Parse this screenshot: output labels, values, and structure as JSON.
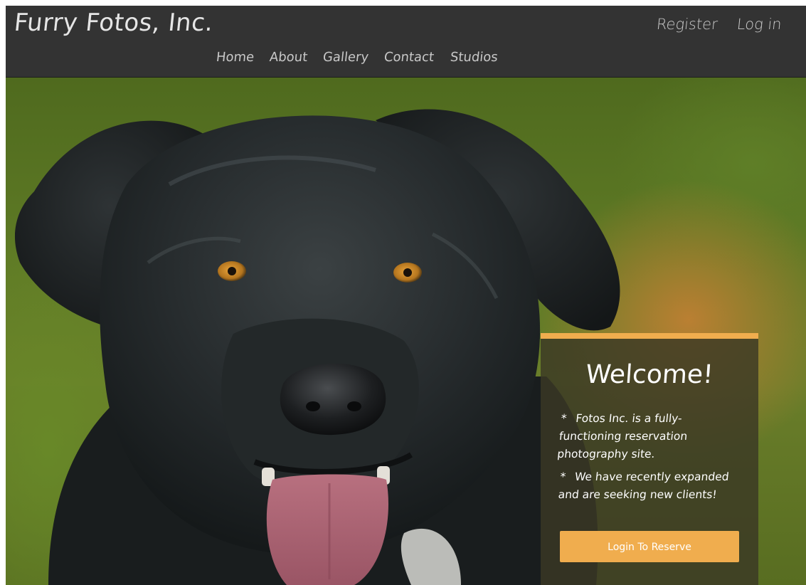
{
  "brand": {
    "name": "Furry Fotos, Inc."
  },
  "auth": {
    "register": "Register",
    "login": "Log in"
  },
  "nav": {
    "items": [
      {
        "label": "Home"
      },
      {
        "label": "About"
      },
      {
        "label": "Gallery"
      },
      {
        "label": "Contact"
      },
      {
        "label": "Studios"
      }
    ]
  },
  "welcome": {
    "title": "Welcome!",
    "bullet_symbol": "*",
    "bullet1": "Fotos Inc. is a fully-functioning reservation photography site.",
    "bullet2": "We have recently expanded and are seeking new clients!",
    "cta": "Login To Reserve"
  },
  "colors": {
    "navbar": "#333333",
    "accent": "#f0ad4e",
    "panel": "#3a3824"
  },
  "icons": {
    "hero_image": "black-dog-photo"
  }
}
